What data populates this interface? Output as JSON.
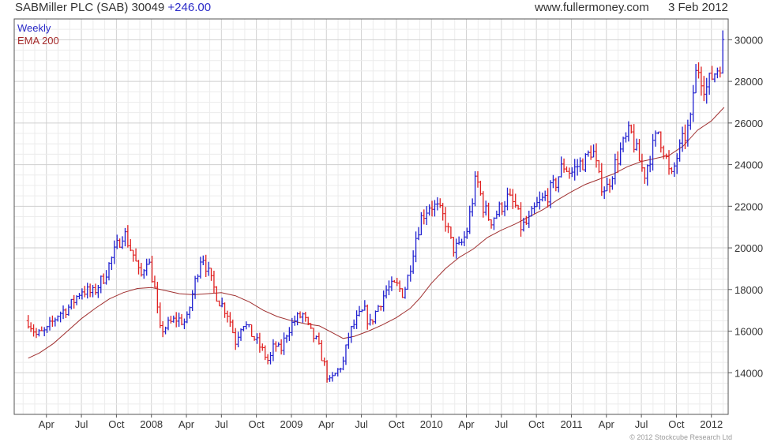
{
  "header": {
    "ticker": "SABMiller PLC (SAB) 30049",
    "change": "+246.00",
    "source": "www.fullermoney.com",
    "date": "3 Feb 2012"
  },
  "legend": {
    "weekly": "Weekly",
    "ema": "EMA 200"
  },
  "footer": {
    "copyright": "© 2012 Stockcube Research Ltd"
  },
  "colors": {
    "up": "#2020d0",
    "down": "#e02020",
    "ema": "#a03030",
    "grid": "#dcdcdc"
  },
  "chart_data": {
    "type": "line",
    "title": "SABMiller PLC (SAB) 30049 +246.00",
    "xlabel": "",
    "ylabel": "",
    "x_tick_labels": [
      "Apr",
      "Jul",
      "Oct",
      "2008",
      "Apr",
      "Jul",
      "Oct",
      "2009",
      "Apr",
      "Jul",
      "Oct",
      "2010",
      "Apr",
      "Jul",
      "Oct",
      "2011",
      "Apr",
      "Jul",
      "Oct",
      "2012"
    ],
    "y_ticks": [
      14000,
      16000,
      18000,
      20000,
      22000,
      24000,
      26000,
      28000,
      30000
    ],
    "ylim": [
      12000,
      31000
    ],
    "grid": true,
    "legend_position": "top-left",
    "series": [
      {
        "name": "Weekly",
        "kind": "price",
        "anchors": [
          [
            2007.12,
            16500
          ],
          [
            2007.18,
            15800
          ],
          [
            2007.25,
            16000
          ],
          [
            2007.33,
            16800
          ],
          [
            2007.42,
            17200
          ],
          [
            2007.5,
            18000
          ],
          [
            2007.58,
            17800
          ],
          [
            2007.66,
            18600
          ],
          [
            2007.75,
            20000
          ],
          [
            2007.8,
            20800
          ],
          [
            2007.88,
            19500
          ],
          [
            2007.92,
            18500
          ],
          [
            2007.97,
            19600
          ],
          [
            2008.02,
            18200
          ],
          [
            2008.06,
            16000
          ],
          [
            2008.12,
            16300
          ],
          [
            2008.18,
            16600
          ],
          [
            2008.25,
            16400
          ],
          [
            2008.3,
            18000
          ],
          [
            2008.36,
            19800
          ],
          [
            2008.42,
            18500
          ],
          [
            2008.48,
            17500
          ],
          [
            2008.55,
            16800
          ],
          [
            2008.6,
            15500
          ],
          [
            2008.65,
            16500
          ],
          [
            2008.72,
            15800
          ],
          [
            2008.78,
            15200
          ],
          [
            2008.84,
            14500
          ],
          [
            2008.88,
            15400
          ],
          [
            2008.92,
            15000
          ],
          [
            2008.97,
            16000
          ],
          [
            2009.02,
            16500
          ],
          [
            2009.08,
            16800
          ],
          [
            2009.13,
            16000
          ],
          [
            2009.18,
            15500
          ],
          [
            2009.23,
            14500
          ],
          [
            2009.27,
            13500
          ],
          [
            2009.32,
            14000
          ],
          [
            2009.37,
            14500
          ],
          [
            2009.41,
            15800
          ],
          [
            2009.46,
            16500
          ],
          [
            2009.52,
            17000
          ],
          [
            2009.56,
            16300
          ],
          [
            2009.62,
            17200
          ],
          [
            2009.68,
            18000
          ],
          [
            2009.75,
            18200
          ],
          [
            2009.8,
            17800
          ],
          [
            2009.84,
            18800
          ],
          [
            2009.88,
            20300
          ],
          [
            2009.93,
            21500
          ],
          [
            2009.99,
            22100
          ],
          [
            2010.04,
            21900
          ],
          [
            2010.1,
            21300
          ],
          [
            2010.15,
            20000
          ],
          [
            2010.2,
            20000
          ],
          [
            2010.25,
            20700
          ],
          [
            2010.28,
            21800
          ],
          [
            2010.32,
            23400
          ],
          [
            2010.37,
            22000
          ],
          [
            2010.42,
            21300
          ],
          [
            2010.48,
            21800
          ],
          [
            2010.54,
            22400
          ],
          [
            2010.6,
            22000
          ],
          [
            2010.64,
            21000
          ],
          [
            2010.69,
            21200
          ],
          [
            2010.75,
            22000
          ],
          [
            2010.81,
            22400
          ],
          [
            2010.88,
            23000
          ],
          [
            2010.94,
            24000
          ],
          [
            2011.0,
            23600
          ],
          [
            2011.05,
            24000
          ],
          [
            2011.1,
            24200
          ],
          [
            2011.15,
            24800
          ],
          [
            2011.2,
            23200
          ],
          [
            2011.25,
            22800
          ],
          [
            2011.3,
            23800
          ],
          [
            2011.36,
            24800
          ],
          [
            2011.42,
            25600
          ],
          [
            2011.47,
            24500
          ],
          [
            2011.52,
            23500
          ],
          [
            2011.57,
            24600
          ],
          [
            2011.62,
            25600
          ],
          [
            2011.67,
            24500
          ],
          [
            2011.71,
            23200
          ],
          [
            2011.75,
            24300
          ],
          [
            2011.8,
            25200
          ],
          [
            2011.85,
            26000
          ],
          [
            2011.87,
            27500
          ],
          [
            2011.9,
            28800
          ],
          [
            2011.93,
            28200
          ],
          [
            2011.96,
            27600
          ],
          [
            2012.0,
            28200
          ],
          [
            2012.03,
            28500
          ],
          [
            2012.06,
            28800
          ],
          [
            2012.09,
            30049
          ]
        ]
      },
      {
        "name": "EMA 200",
        "kind": "line",
        "points": [
          [
            2007.12,
            14700
          ],
          [
            2007.2,
            14950
          ],
          [
            2007.3,
            15400
          ],
          [
            2007.4,
            16000
          ],
          [
            2007.5,
            16600
          ],
          [
            2007.6,
            17100
          ],
          [
            2007.7,
            17550
          ],
          [
            2007.8,
            17850
          ],
          [
            2007.9,
            18050
          ],
          [
            2008.0,
            18100
          ],
          [
            2008.1,
            17950
          ],
          [
            2008.2,
            17800
          ],
          [
            2008.3,
            17750
          ],
          [
            2008.4,
            17800
          ],
          [
            2008.5,
            17850
          ],
          [
            2008.6,
            17700
          ],
          [
            2008.7,
            17400
          ],
          [
            2008.8,
            17000
          ],
          [
            2008.9,
            16700
          ],
          [
            2009.0,
            16500
          ],
          [
            2009.1,
            16350
          ],
          [
            2009.2,
            16250
          ],
          [
            2009.3,
            15900
          ],
          [
            2009.37,
            15650
          ],
          [
            2009.45,
            15750
          ],
          [
            2009.55,
            16000
          ],
          [
            2009.65,
            16300
          ],
          [
            2009.75,
            16650
          ],
          [
            2009.85,
            17100
          ],
          [
            2009.92,
            17600
          ],
          [
            2010.0,
            18300
          ],
          [
            2010.1,
            19000
          ],
          [
            2010.2,
            19550
          ],
          [
            2010.3,
            19950
          ],
          [
            2010.4,
            20500
          ],
          [
            2010.5,
            20850
          ],
          [
            2010.6,
            21150
          ],
          [
            2010.7,
            21500
          ],
          [
            2010.8,
            21850
          ],
          [
            2010.9,
            22300
          ],
          [
            2011.0,
            22700
          ],
          [
            2011.1,
            23050
          ],
          [
            2011.2,
            23300
          ],
          [
            2011.3,
            23550
          ],
          [
            2011.4,
            23900
          ],
          [
            2011.5,
            24150
          ],
          [
            2011.6,
            24300
          ],
          [
            2011.7,
            24450
          ],
          [
            2011.8,
            24900
          ],
          [
            2011.9,
            25650
          ],
          [
            2012.0,
            26100
          ],
          [
            2012.09,
            26750
          ]
        ]
      }
    ]
  }
}
